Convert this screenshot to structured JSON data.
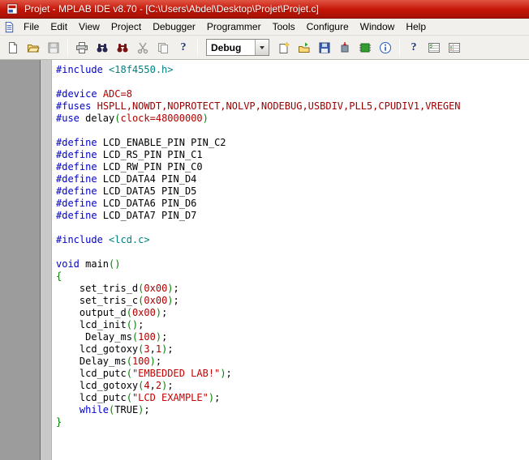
{
  "window": {
    "title": "Projet - MPLAB IDE v8.70 - [C:\\Users\\Abdel\\Desktop\\Projet\\Projet.c]",
    "title_bar_color": "#c41507"
  },
  "menu_bar": {
    "items": [
      "File",
      "Edit",
      "View",
      "Project",
      "Debugger",
      "Programmer",
      "Tools",
      "Configure",
      "Window",
      "Help"
    ]
  },
  "toolbar": {
    "mode_select": "Debug",
    "buttons": [
      "new-file",
      "open-file",
      "save-file",
      "print",
      "find",
      "find-in-files",
      "cut",
      "copy",
      "help",
      "debug-mode-select",
      "new-project",
      "open-project",
      "save-workspace",
      "program-target",
      "read-target",
      "target-info",
      "help-topics",
      "checklist-window-1",
      "checklist-window-2"
    ]
  },
  "editor": {
    "workspace_bg": "#9c9c9c",
    "token_colors": {
      "kw": "#0000cc",
      "inc": "#008080",
      "val": "#b00000",
      "fus": "#990000",
      "str": "#c80000",
      "par": "#008000",
      "pl": "#000000"
    },
    "lines": [
      [
        [
          "kw",
          "#include"
        ],
        [
          "pl",
          " "
        ],
        [
          "inc",
          "<18f4550.h>"
        ]
      ],
      [],
      [
        [
          "kw",
          "#device"
        ],
        [
          "pl",
          " "
        ],
        [
          "val",
          "ADC=8"
        ]
      ],
      [
        [
          "kw",
          "#fuses"
        ],
        [
          "pl",
          " "
        ],
        [
          "fus",
          "HSPLL,NOWDT,NOPROTECT,NOLVP,NODEBUG,USBDIV,PLL5,CPUDIV1,VREGEN"
        ]
      ],
      [
        [
          "kw",
          "#use"
        ],
        [
          "pl",
          " delay"
        ],
        [
          "par",
          "("
        ],
        [
          "val",
          "clock=48000000"
        ],
        [
          "par",
          ")"
        ]
      ],
      [],
      [
        [
          "kw",
          "#define"
        ],
        [
          "pl",
          " LCD_ENABLE_PIN PIN_C2"
        ]
      ],
      [
        [
          "kw",
          "#define"
        ],
        [
          "pl",
          " LCD_RS_PIN PIN_C1"
        ]
      ],
      [
        [
          "kw",
          "#define"
        ],
        [
          "pl",
          " LCD_RW_PIN PIN_C0"
        ]
      ],
      [
        [
          "kw",
          "#define"
        ],
        [
          "pl",
          " LCD_DATA4 PIN_D4"
        ]
      ],
      [
        [
          "kw",
          "#define"
        ],
        [
          "pl",
          " LCD_DATA5 PIN_D5"
        ]
      ],
      [
        [
          "kw",
          "#define"
        ],
        [
          "pl",
          " LCD_DATA6 PIN_D6"
        ]
      ],
      [
        [
          "kw",
          "#define"
        ],
        [
          "pl",
          " LCD_DATA7 PIN_D7"
        ]
      ],
      [],
      [
        [
          "kw",
          "#include"
        ],
        [
          "pl",
          " "
        ],
        [
          "inc",
          "<lcd.c>"
        ]
      ],
      [],
      [
        [
          "kw",
          "void"
        ],
        [
          "pl",
          " main"
        ],
        [
          "par",
          "()"
        ]
      ],
      [
        [
          "par",
          "{"
        ]
      ],
      [
        [
          "pl",
          "    set_tris_d"
        ],
        [
          "par",
          "("
        ],
        [
          "val",
          "0x00"
        ],
        [
          "par",
          ")"
        ],
        [
          "pl",
          ";"
        ]
      ],
      [
        [
          "pl",
          "    set_tris_c"
        ],
        [
          "par",
          "("
        ],
        [
          "val",
          "0x00"
        ],
        [
          "par",
          ")"
        ],
        [
          "pl",
          ";"
        ]
      ],
      [
        [
          "pl",
          "    output_d"
        ],
        [
          "par",
          "("
        ],
        [
          "val",
          "0x00"
        ],
        [
          "par",
          ")"
        ],
        [
          "pl",
          ";"
        ]
      ],
      [
        [
          "pl",
          "    lcd_init"
        ],
        [
          "par",
          "()"
        ],
        [
          "pl",
          ";"
        ]
      ],
      [
        [
          "pl",
          "     Delay_ms"
        ],
        [
          "par",
          "("
        ],
        [
          "val",
          "100"
        ],
        [
          "par",
          ")"
        ],
        [
          "pl",
          ";"
        ]
      ],
      [
        [
          "pl",
          "    lcd_gotoxy"
        ],
        [
          "par",
          "("
        ],
        [
          "val",
          "3"
        ],
        [
          "pl",
          ","
        ],
        [
          "val",
          "1"
        ],
        [
          "par",
          ")"
        ],
        [
          "pl",
          ";"
        ]
      ],
      [
        [
          "pl",
          "    Delay_ms"
        ],
        [
          "par",
          "("
        ],
        [
          "val",
          "100"
        ],
        [
          "par",
          ")"
        ],
        [
          "pl",
          ";"
        ]
      ],
      [
        [
          "pl",
          "    lcd_putc"
        ],
        [
          "par",
          "("
        ],
        [
          "str",
          "\"EMBEDDED LAB!\""
        ],
        [
          "par",
          ")"
        ],
        [
          "pl",
          ";"
        ]
      ],
      [
        [
          "pl",
          "    lcd_gotoxy"
        ],
        [
          "par",
          "("
        ],
        [
          "val",
          "4"
        ],
        [
          "pl",
          ","
        ],
        [
          "val",
          "2"
        ],
        [
          "par",
          ")"
        ],
        [
          "pl",
          ";"
        ]
      ],
      [
        [
          "pl",
          "    lcd_putc"
        ],
        [
          "par",
          "("
        ],
        [
          "str",
          "\"LCD EXAMPLE\""
        ],
        [
          "par",
          ")"
        ],
        [
          "pl",
          ";"
        ]
      ],
      [
        [
          "pl",
          "    "
        ],
        [
          "kw",
          "while"
        ],
        [
          "par",
          "("
        ],
        [
          "pl",
          "TRUE"
        ],
        [
          "par",
          ")"
        ],
        [
          "pl",
          ";"
        ]
      ],
      [
        [
          "par",
          "}"
        ]
      ]
    ]
  }
}
